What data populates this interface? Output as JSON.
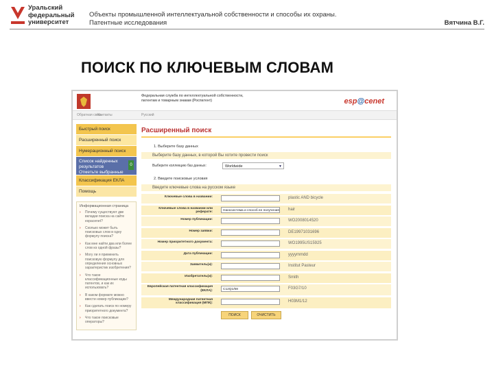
{
  "header": {
    "logo_lines": [
      "Уральский",
      "федеральный",
      "университет"
    ],
    "course_line1": "Объекты промышленной интеллектуальной собственности и способы их охраны.",
    "course_line2": "Патентные исследования",
    "author": "Вятчина В.Г."
  },
  "slide_title": "ПОИСК ПО КЛЮЧЕВЫМ СЛОВАМ",
  "screenshot": {
    "agency_lines": [
      "Федеральная служба по интеллектуальной собственности,",
      "патентам и товарным знакам (Роспатент)"
    ],
    "brand_part1": "esp",
    "brand_at": "@",
    "brand_part2": "cenet",
    "nav_items": [
      "Обратная связь",
      "Контакты",
      "Русский"
    ],
    "sidebar": {
      "items": [
        "Быстрый поиск",
        "Расширенный поиск",
        "Нумерационный поиск"
      ],
      "selected_line1": "Список найденных результатов",
      "selected_line2": "Отметьте выбранные документы",
      "selected_badge": "0",
      "items_after": [
        "Классификация ЕКЛА",
        "Помощь"
      ],
      "info_head": "Информационная страница",
      "info_questions": [
        "Почему существуют две вкладки поиска на сайте espacenet?",
        "Сколько может быть поисковых слов в одну формулу поиска?",
        "Как мне найти два или более слов из одной фразы?",
        "Могу ли я применить поисковую формулу для определения основных характеристик изобретения?",
        "Что такое классификационные коды патентов, и как их использовать?",
        "В каком формате можно ввести номер публикации?",
        "Как сделать поиск по номеру приоритетного документа?",
        "Что такое поисковые операторы?"
      ]
    },
    "main": {
      "title": "Расширенный поиск",
      "step1": "1. Выберите базу данных",
      "band1": "Выберите базу данных, в которой Вы хотите провести поиск",
      "db_label": "Выберите коллекцию баз данных:",
      "db_value": "Worldwide",
      "step2": "2. Введите поисковые условия",
      "band2": "Введите ключевые слова на русском языке",
      "fields": [
        {
          "label": "Ключевые слова в названии:",
          "value": "",
          "example": "plastic AND bicycle"
        },
        {
          "label": "Ключевые слова в названии или реферате:",
          "value": "Наносистема и способ ее получения",
          "example": "hair"
        },
        {
          "label": "Номер публикации:",
          "value": "",
          "example": "WO2008014520"
        },
        {
          "label": "Номер заявки:",
          "value": "",
          "example": "DE19971031696"
        },
        {
          "label": "Номер приоритетного документа:",
          "value": "",
          "example": "WO1995US15925"
        },
        {
          "label": "Дата публикации:",
          "value": "",
          "example": "yyyymmdd"
        },
        {
          "label": "Заявитель(и):",
          "value": "",
          "example": "Institut Pasteur"
        },
        {
          "label": "Изобретатель(и):",
          "value": "",
          "example": "Smith"
        },
        {
          "label": "Европейская патентная классификация (ЕКЛА):",
          "value": "C12Q1/68",
          "example": "F03G7/10"
        },
        {
          "label": "Международная патентная классификация (МПК):",
          "value": "",
          "example": "H03M1/12"
        }
      ],
      "search_button": "ПОИСК",
      "clear_button": "ОЧИСТИТЬ"
    }
  },
  "colors": {
    "accent_red": "#c8362c",
    "sidebar_yellow": "#fde7a0",
    "selected_blue": "#5a6fa8"
  }
}
